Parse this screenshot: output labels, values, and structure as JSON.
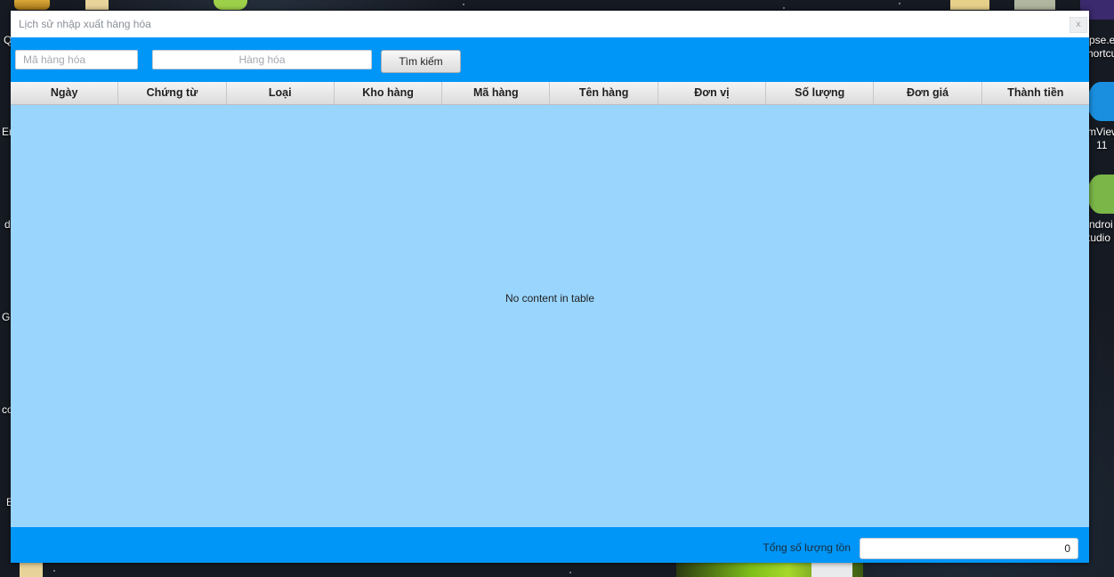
{
  "window": {
    "title": "Lịch sử nhập xuất hàng hóa",
    "close_label": "x"
  },
  "search": {
    "code_placeholder": "Mã hàng hóa",
    "name_placeholder": "Hàng hóa",
    "button_label": "Tìm kiếm"
  },
  "table": {
    "columns": [
      "Ngày",
      "Chứng từ",
      "Loại",
      "Kho hàng",
      "Mã hàng",
      "Tên hàng",
      "Đơn vị",
      "Số lượng",
      "Đơn giá",
      "Thành tiền"
    ],
    "empty_text": "No content in table"
  },
  "footer": {
    "total_label": "Tổng số lượng tồn",
    "total_value": "0"
  },
  "desktop": {
    "left_labels": [
      "Q",
      "Er",
      "d",
      "Gi",
      "co",
      "E"
    ],
    "right_labels": [
      "pse.ex",
      "hortcu",
      "mView",
      "11",
      "ndroi",
      "tudio"
    ]
  },
  "colors": {
    "window_bg": "#0096f8",
    "table_bg": "#99d5fd"
  }
}
